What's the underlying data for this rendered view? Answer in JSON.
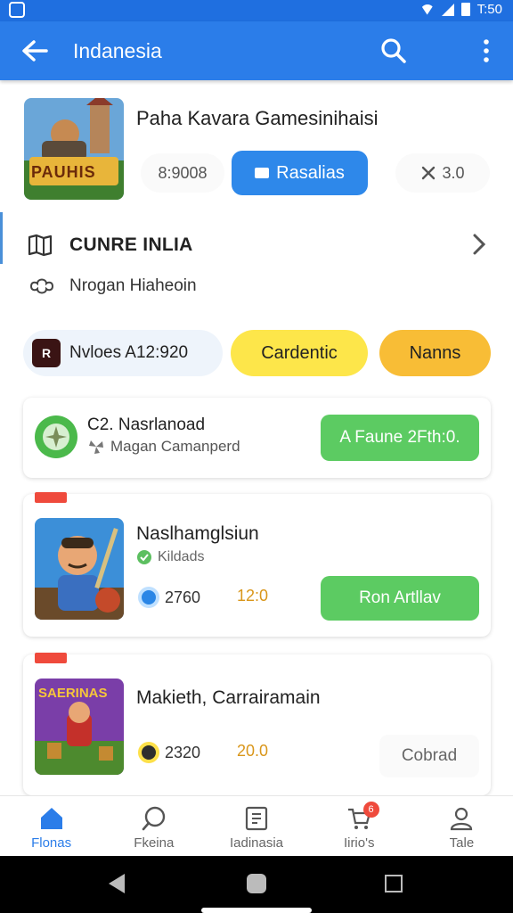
{
  "appbar": {
    "title": "Indanesia"
  },
  "status": {
    "time": "T:50"
  },
  "hero": {
    "title": "Paha Kavara Gamesinihaisi",
    "count": "8:9008",
    "button_label": "Rasalias",
    "rating": "3.0",
    "icon_label": "PAUHIS"
  },
  "section": {
    "title": "CUNRE INLIA",
    "subtitle": "Nrogan Hiaheoin"
  },
  "chips": {
    "chip_a_label": "Nvloes A12:920",
    "chip_a_badge": "R",
    "chip_b_label": "Cardentic",
    "chip_c_label": "Nanns"
  },
  "card1": {
    "title": "C2. Nasrlanoad",
    "subtitle": "Magan Camanperd",
    "button_label": "A Faune 2Fth:0."
  },
  "card2": {
    "title": "Naslhamglsiun",
    "subtitle": "Kildads",
    "stat": "2760",
    "score": "12:0",
    "button_label": "Ron Artllav"
  },
  "card3": {
    "title": "Makieth, Carrairamain",
    "stat": "2320",
    "score": "20.0",
    "button_label": "Cobrad",
    "icon_label": "SAERINAS"
  },
  "nav": {
    "items": [
      {
        "label": "Flonas"
      },
      {
        "label": "Fkeina"
      },
      {
        "label": "Iadinasia"
      },
      {
        "label": "Iirio's"
      },
      {
        "label": "Tale"
      }
    ],
    "badge": "6"
  },
  "colors": {
    "primary": "#2b7de9",
    "green": "#5ccb62",
    "yellow": "#fde64a",
    "orange": "#f8bd36",
    "red": "#ef4a3c"
  }
}
